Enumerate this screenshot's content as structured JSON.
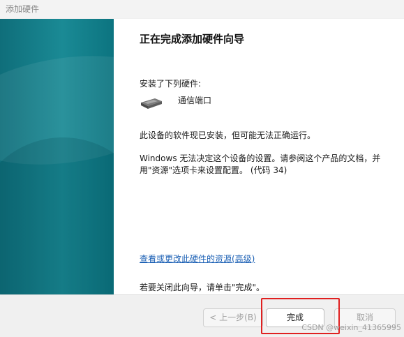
{
  "window": {
    "title": "添加硬件"
  },
  "page": {
    "title": "正在完成添加硬件向导",
    "installed_label": "安装了下列硬件:",
    "device_name": "通信端口",
    "device_icon": "serial-port-icon",
    "status_line": "此设备的软件现已安装，但可能无法正确运行。",
    "error_text": "Windows 无法决定这个设备的设置。请参阅这个产品的文档，并用\"资源\"选项卡来设置配置。 (代码 34)",
    "resource_link": "查看或更改此硬件的资源(高级)",
    "finish_hint": "若要关闭此向导，请单击\"完成\"。"
  },
  "buttons": {
    "back": "< 上一步(B)",
    "finish": "完成",
    "cancel": "取消"
  },
  "annotation": {
    "highlight_color": "#e02020"
  },
  "watermark": "CSDN @weixin_41365995"
}
